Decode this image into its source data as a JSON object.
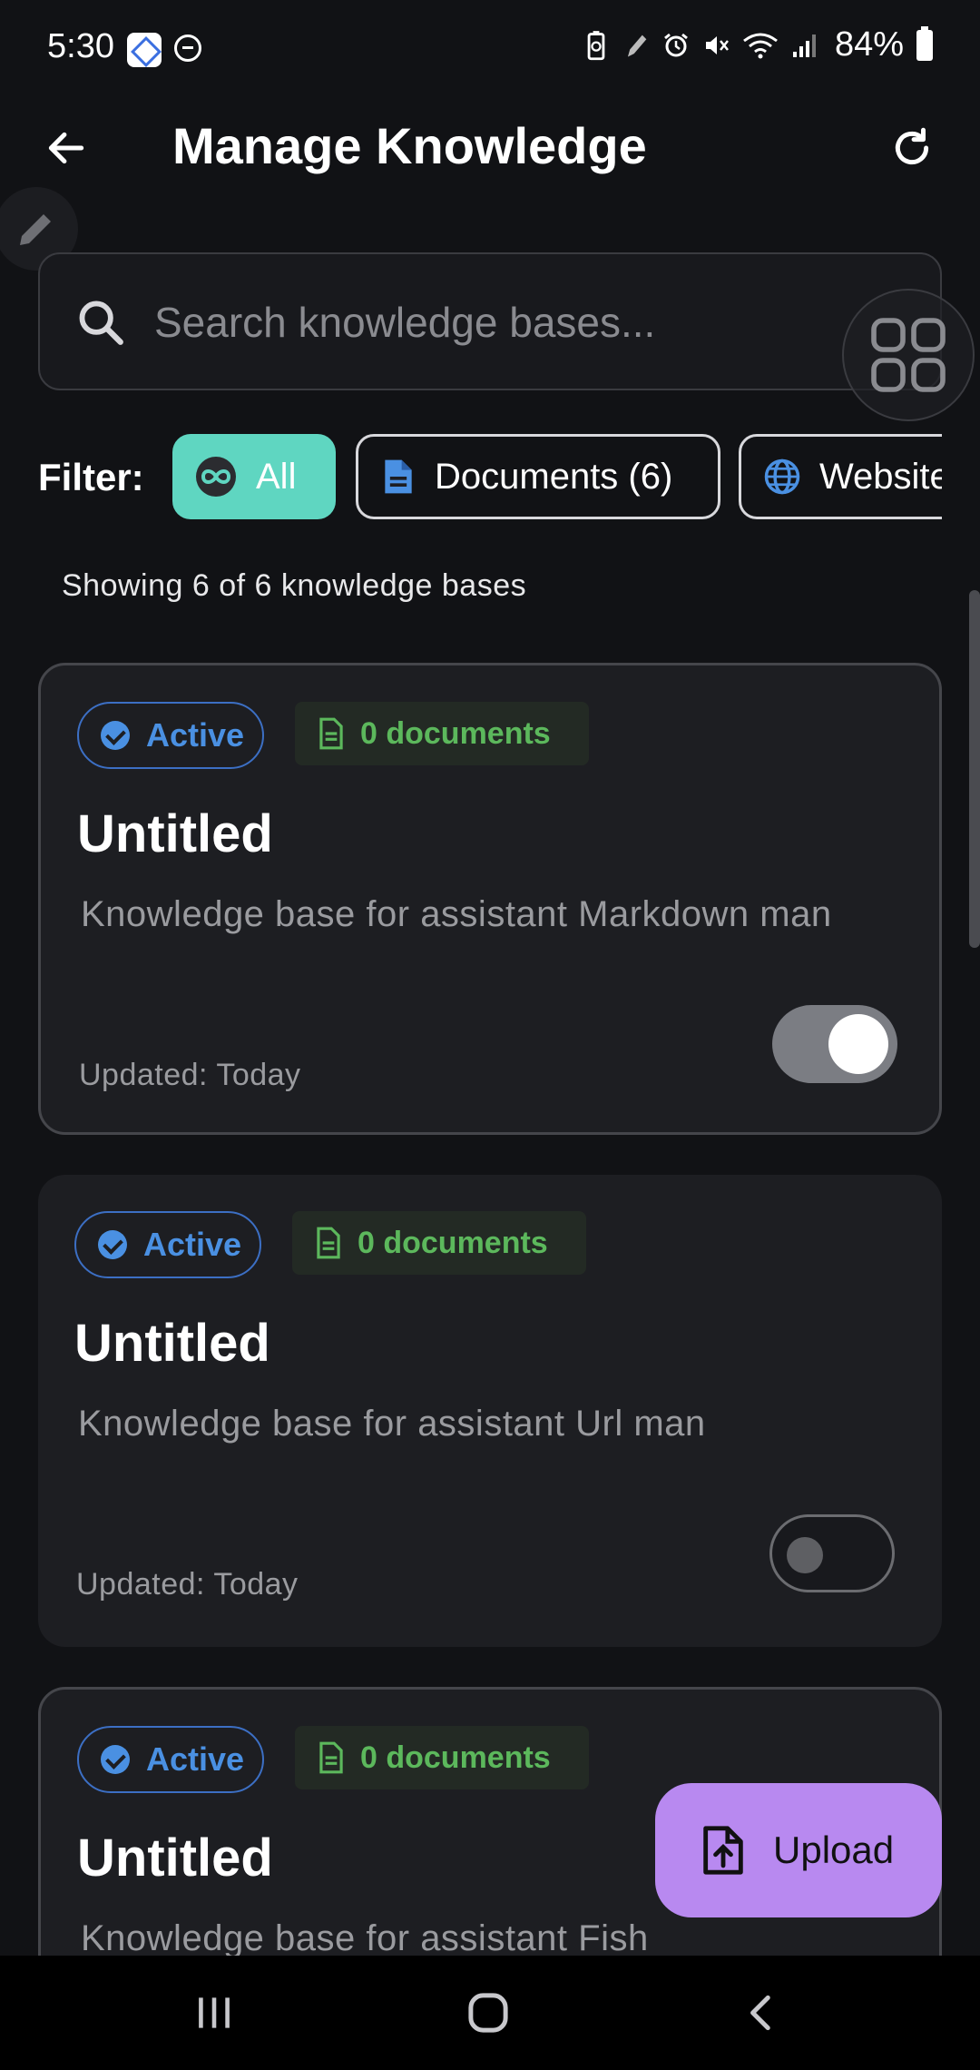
{
  "status_bar": {
    "time": "5:30",
    "battery": "84%"
  },
  "app_bar": {
    "title": "Manage Knowledge"
  },
  "search": {
    "placeholder": "Search knowledge bases..."
  },
  "filter": {
    "label": "Filter:",
    "chips": [
      {
        "label": "All",
        "icon": "all-inclusive-icon",
        "selected": true
      },
      {
        "label": "Documents (6)",
        "icon": "document-icon",
        "selected": false
      },
      {
        "label": "Website",
        "icon": "globe-icon",
        "selected": false
      }
    ]
  },
  "summary": "Showing 6 of 6 knowledge bases",
  "cards": [
    {
      "status": "Active",
      "docs": "0 documents",
      "title": "Untitled",
      "description": "Knowledge base for assistant Markdown man",
      "updated": "Updated: Today",
      "enabled": true
    },
    {
      "status": "Active",
      "docs": "0 documents",
      "title": "Untitled",
      "description": "Knowledge base for assistant Url man",
      "updated": "Updated: Today",
      "enabled": false
    },
    {
      "status": "Active",
      "docs": "0 documents",
      "title": "Untitled",
      "description": "Knowledge base for assistant Fish",
      "updated": "",
      "enabled": false
    }
  ],
  "fab": {
    "label": "Upload"
  },
  "colors": {
    "accent_teal": "#5fd6c1",
    "active_blue": "#4a90e2",
    "docs_green": "#5cb85c",
    "fab_purple": "#b889f0"
  }
}
